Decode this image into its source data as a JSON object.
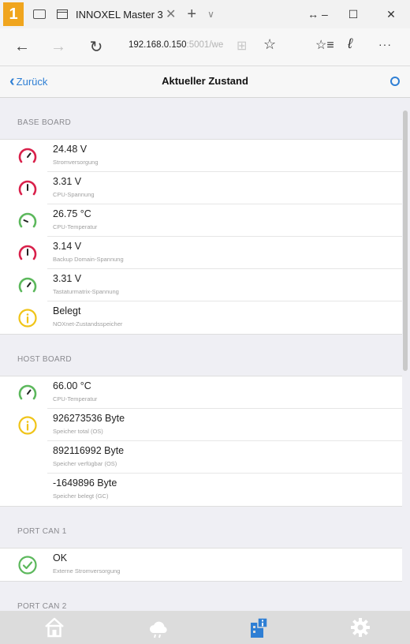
{
  "browser": {
    "badge": "1",
    "tab_title": "INNOXEL Master 3",
    "tab_close": "✕",
    "new_tab": "+",
    "tab_list": "∨",
    "url_main": "192.168.0.150",
    "url_rest": ":5001/we",
    "nav_back": "←",
    "nav_forward": "→",
    "nav_refresh": "↻",
    "reading": "⊞",
    "star": "☆",
    "favorites": "☆≡",
    "pen": "ℓ",
    "more": "···",
    "win_restore": "↔ –",
    "win_max": "☐",
    "win_close": "✕"
  },
  "app": {
    "back_label": "Zurück",
    "title": "Aktueller Zustand"
  },
  "colors": {
    "accent": "#2f7fd4",
    "ok": "#5cb85c",
    "warn": "#f0c419",
    "critical": "#d9214b"
  },
  "sections": [
    {
      "title": "BASE BOARD",
      "rows": [
        {
          "icon": "gauge-red-icon",
          "value": "24.48 V",
          "label": "Stromversorgung"
        },
        {
          "icon": "gauge-red-icon",
          "value": "3.31 V",
          "label": "CPU-Spannung"
        },
        {
          "icon": "gauge-green-icon",
          "value": "26.75 °C",
          "label": "CPU-Temperatur"
        },
        {
          "icon": "gauge-red-icon",
          "value": "3.14 V",
          "label": "Backup Domain-Spannung"
        },
        {
          "icon": "gauge-green-icon",
          "value": "3.31 V",
          "label": "Tastaturmatrix-Spannung"
        },
        {
          "icon": "info-yellow-icon",
          "value": "Belegt",
          "label": "NOXnet-Zustandsspeicher"
        }
      ]
    },
    {
      "title": "HOST BOARD",
      "rows": [
        {
          "icon": "gauge-green-icon",
          "value": "66.00 °C",
          "label": "CPU-Temperatur"
        },
        {
          "icon": "info-yellow-icon",
          "value": "926273536 Byte",
          "label": "Speicher total (OS)"
        },
        {
          "icon": "",
          "value": "892116992 Byte",
          "label": "Speicher verfügbar (OS)"
        },
        {
          "icon": "",
          "value": "-1649896 Byte",
          "label": "Speicher belegt (GC)"
        }
      ]
    },
    {
      "title": "PORT CAN 1",
      "rows": [
        {
          "icon": "check-green-icon",
          "value": "OK",
          "label": "Externe Stromversorgung"
        }
      ]
    },
    {
      "title": "PORT CAN 2",
      "rows": []
    }
  ],
  "tabbar": {
    "items": [
      {
        "icon": "home-icon",
        "active": false
      },
      {
        "icon": "weather-icon",
        "active": false
      },
      {
        "icon": "status-icon",
        "active": true
      },
      {
        "icon": "settings-icon",
        "active": false
      }
    ]
  }
}
